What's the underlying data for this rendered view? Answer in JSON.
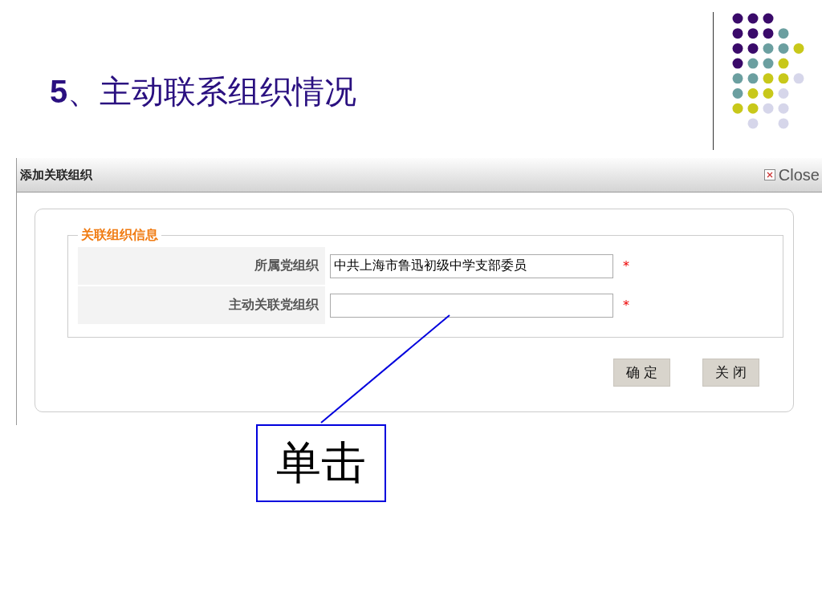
{
  "slide": {
    "title": "**5**、主动联系组织情况"
  },
  "dialog": {
    "title": "添加关联组织",
    "close_label": "Close",
    "legend": "关联组织信息",
    "fields": [
      {
        "label": "所属党组织",
        "value": "中共上海市鲁迅初级中学支部委员",
        "required_mark": "*"
      },
      {
        "label": "主动关联党组织",
        "required_mark": "*"
      }
    ],
    "buttons": [
      "确 定",
      "关 闭"
    ]
  },
  "callout": {
    "text": "单击"
  }
}
